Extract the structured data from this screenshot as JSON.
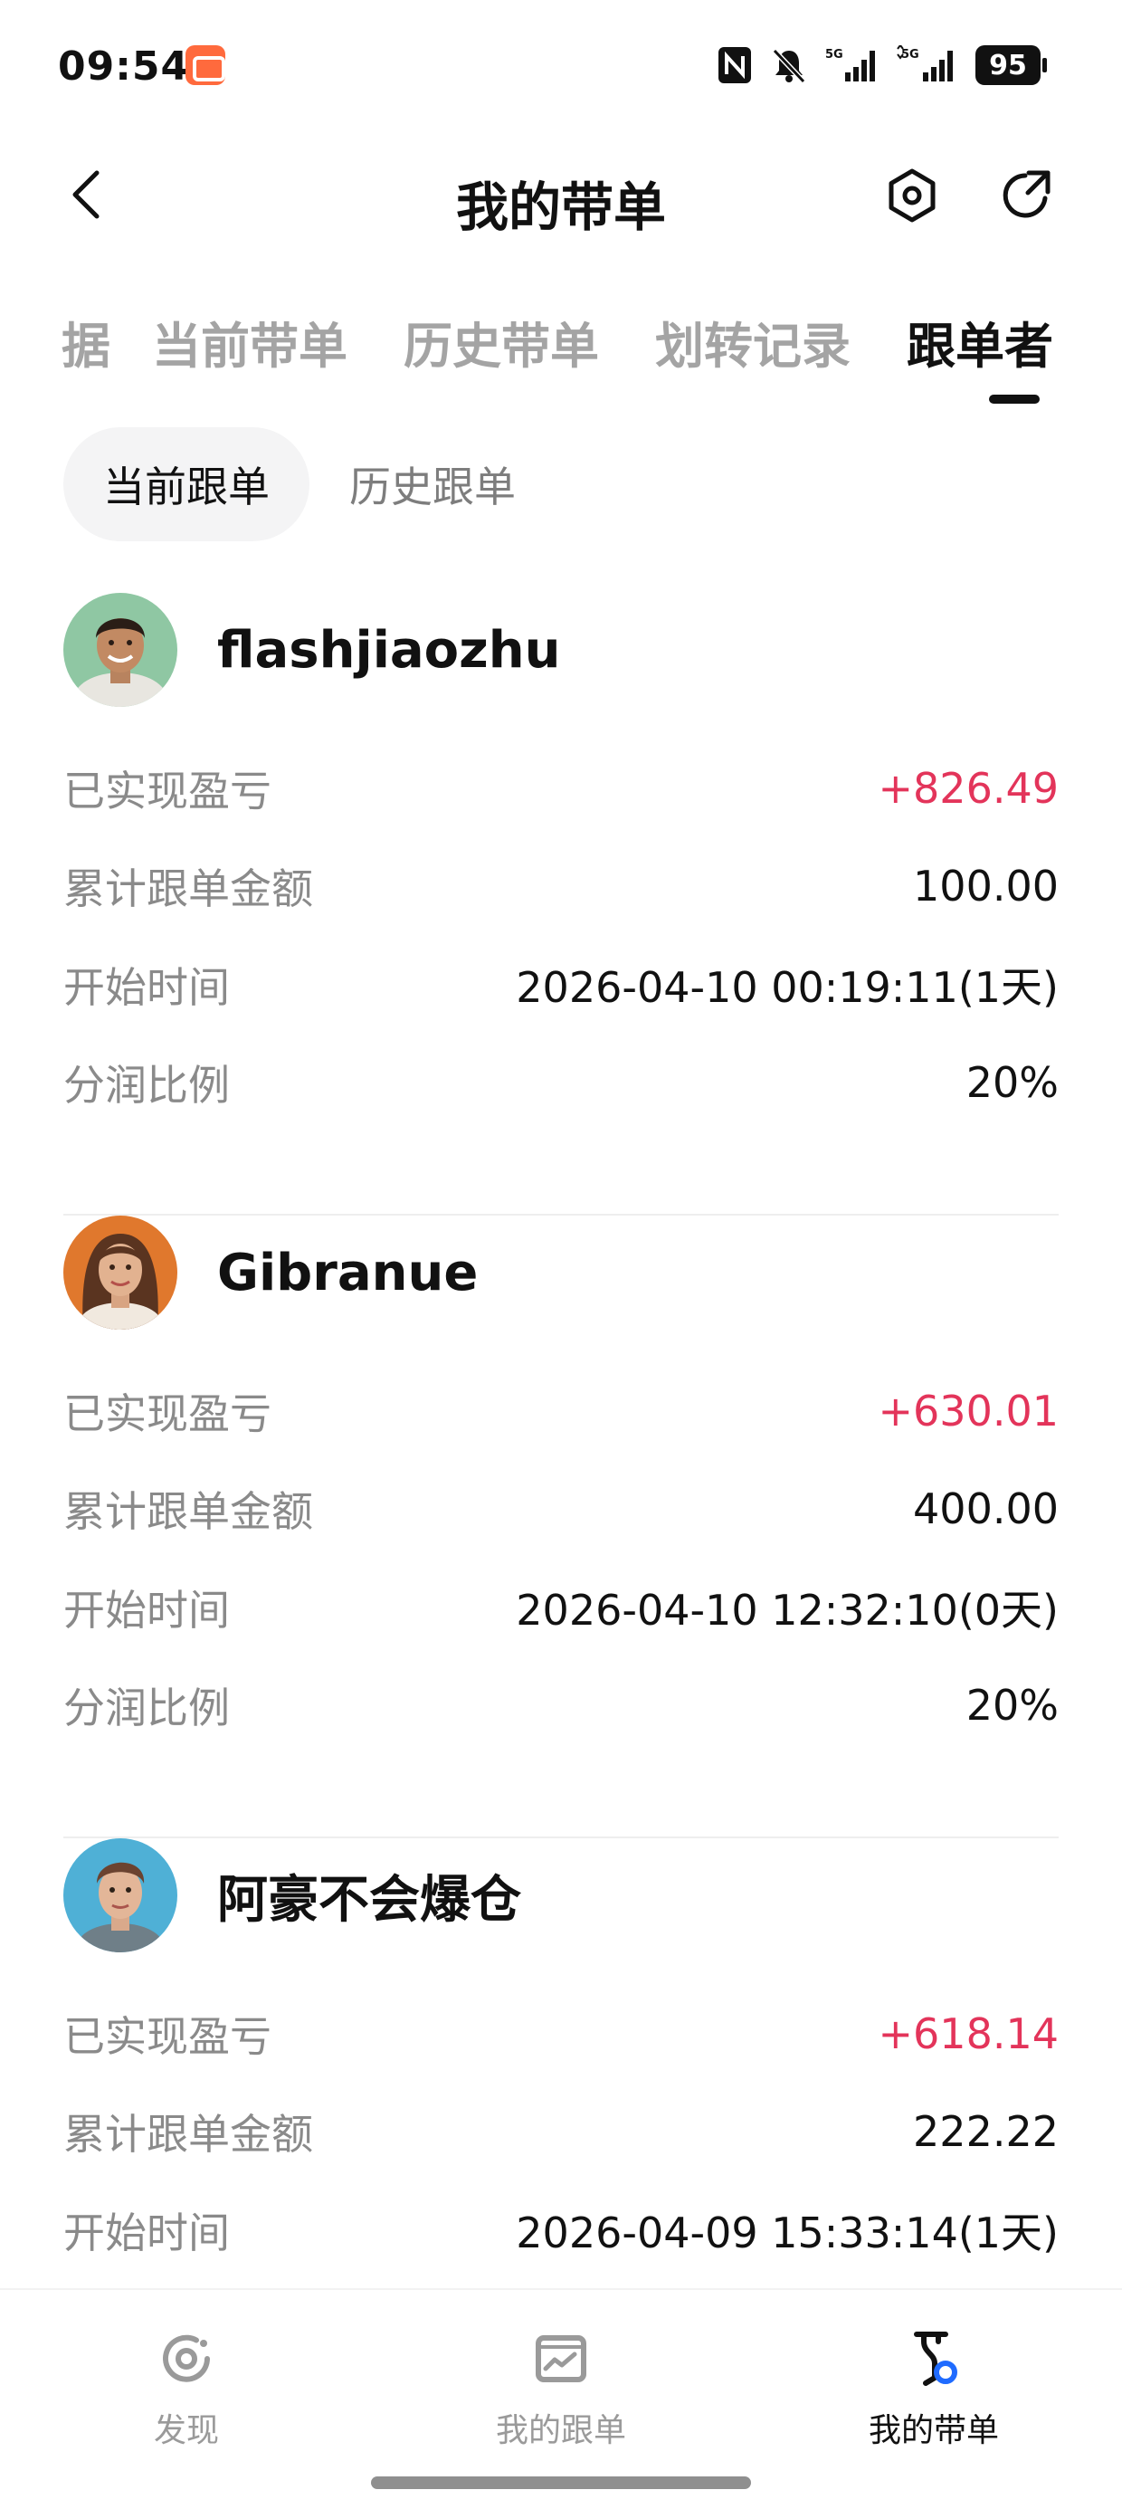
{
  "status_bar": {
    "time": "09:54",
    "network_1": "5G",
    "network_2": "5G",
    "battery": "95"
  },
  "header": {
    "title": "我的带单"
  },
  "tabs": [
    {
      "label": "据",
      "active": false
    },
    {
      "label": "当前带单",
      "active": false
    },
    {
      "label": "历史带单",
      "active": false
    },
    {
      "label": "划转记录",
      "active": false
    },
    {
      "label": "跟单者",
      "active": true
    }
  ],
  "subtabs": [
    {
      "label": "当前跟单",
      "active": true
    },
    {
      "label": "历史跟单",
      "active": false
    }
  ],
  "row_labels": {
    "pnl": "已实现盈亏",
    "total": "累计跟单金额",
    "start": "开始时间",
    "share": "分润比例"
  },
  "followers": [
    {
      "name": "flashjiaozhu",
      "avatar": "avatar-man-smiling",
      "pnl": "+826.49",
      "total": "100.00",
      "start": "2026-04-10 00:19:11(1天)",
      "share": "20%"
    },
    {
      "name": "Gibranue",
      "avatar": "avatar-woman",
      "pnl": "+630.01",
      "total": "400.00",
      "start": "2026-04-10 12:32:10(0天)",
      "share": "20%"
    },
    {
      "name": "阿豪不会爆仓",
      "avatar": "avatar-man",
      "pnl": "+618.14",
      "total": "222.22",
      "start": "2026-04-09 15:33:14(1天)"
    }
  ],
  "bottom_nav": [
    {
      "label": "发现",
      "icon": "discover-icon",
      "active": false
    },
    {
      "label": "我的跟单",
      "icon": "chart-icon",
      "active": false
    },
    {
      "label": "我的带单",
      "icon": "trophy-icon",
      "active": true
    }
  ],
  "colors": {
    "profit": "#e3345a",
    "text": "#111111",
    "muted": "#8a8a8a",
    "inactive_tab": "#a4a4a4",
    "active_nav_dot": "#1f6bff"
  }
}
